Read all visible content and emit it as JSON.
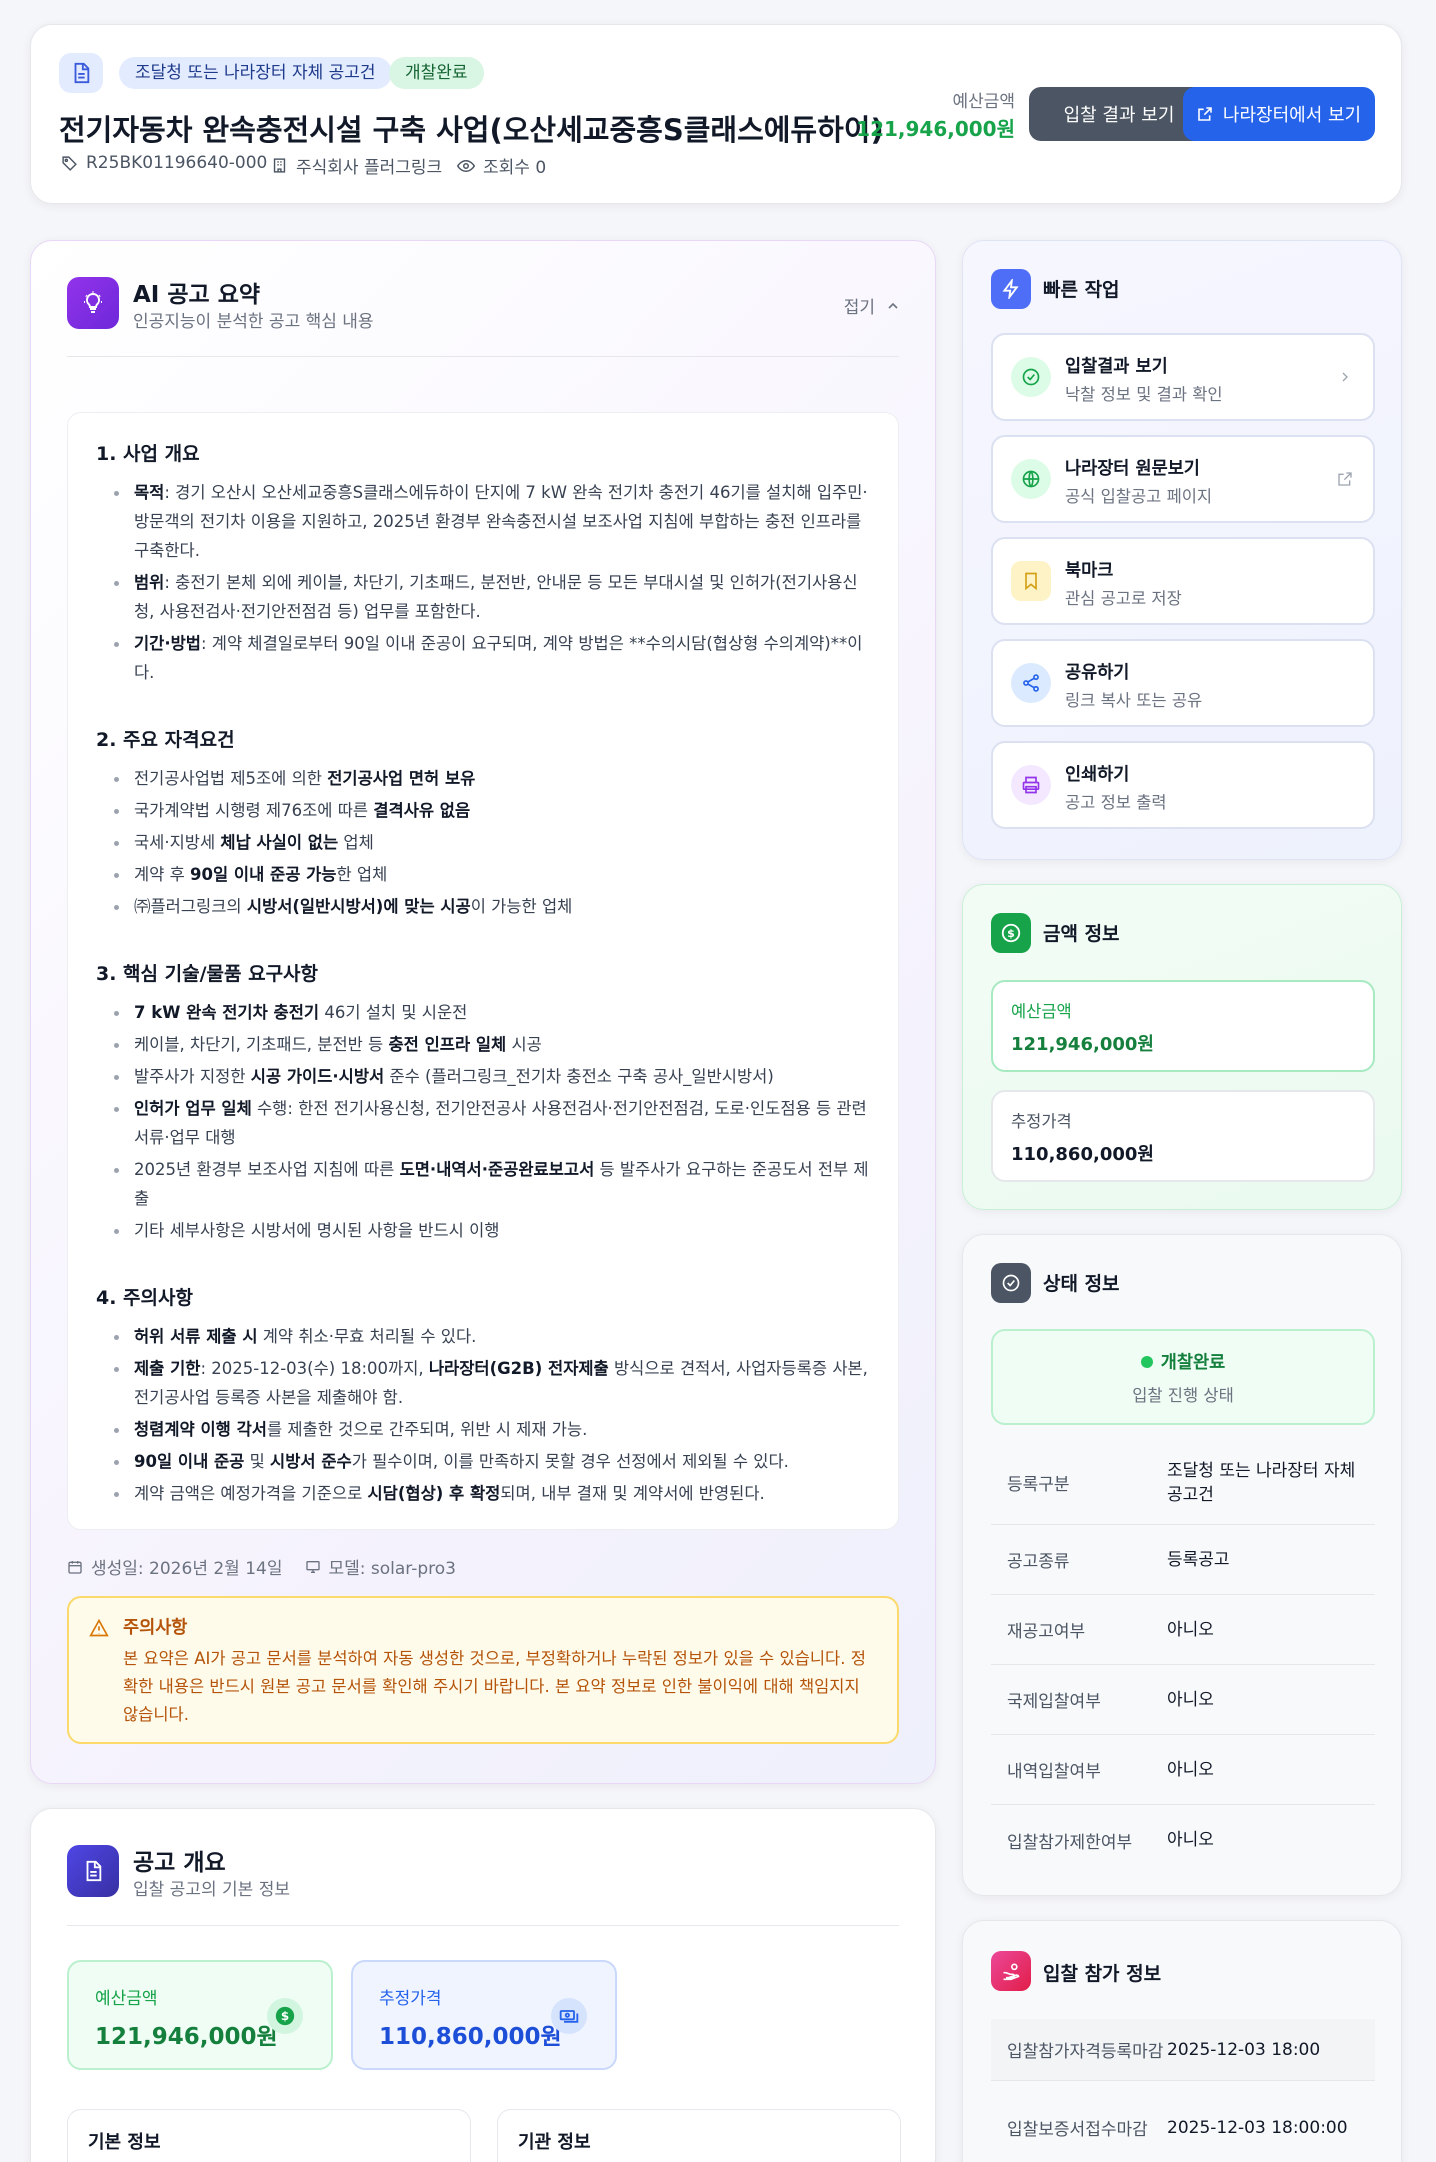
{
  "header": {
    "badges": [
      "조달청 또는 나라장터 자체 공고건",
      "개찰완료"
    ],
    "title": "전기자동차 완속충전시설 구축 사업(오산세교중흥S클래스에듀하이)",
    "notice_no": "R25BK01196640-000",
    "org": "주식회사 플러그링크",
    "views": "조회수 0",
    "budget_label": "예산금액",
    "budget_value": "121,946,000원",
    "btn_result": "입찰 결과 보기",
    "btn_g2b": "나라장터에서 보기",
    "colors": {
      "primary": "#2563eb",
      "success": "#16a34a",
      "dark": "#4b5563"
    }
  },
  "ai": {
    "title": "AI 공고 요약",
    "subtitle": "인공지능이 분석한 공고 핵심 내용",
    "collapse": "접기",
    "s1_title": "1. 사업 개요",
    "s1_i1_k": "목적",
    "s1_i1_v": ": 경기 오산시 오산세교중흥S클래스에듀하이 단지에 7 kW 완속 전기차 충전기 46기를 설치해 입주민·방문객의 전기차 이용을 지원하고, 2025년 환경부 완속충전시설 보조사업 지침에 부합하는 충전 인프라를 구축한다.",
    "s1_i2_k": "범위",
    "s1_i2_v": ": 충전기 본체 외에 케이블, 차단기, 기초패드, 분전반, 안내문 등 모든 부대시설 및 인허가(전기사용신청, 사용전검사·전기안전점검 등) 업무를 포함한다.",
    "s1_i3_k": "기간·방법",
    "s1_i3_v": ": 계약 체결일로부터 90일 이내 준공이 요구되며, 계약 방법은 **수의시담(협상형 수의계약)**이다.",
    "s2_title": "2. 주요 자격요건",
    "s2_i1_a": "전기공사업법 제5조에 의한 ",
    "s2_i1_b": "전기공사업 면허 보유",
    "s2_i2_a": "국가계약법 시행령 제76조에 따른 ",
    "s2_i2_b": "결격사유 없음",
    "s2_i3_a": "국세·지방세 ",
    "s2_i3_b": "체납 사실이 없는",
    "s2_i3_c": " 업체",
    "s2_i4_a": "계약 후 ",
    "s2_i4_b": "90일 이내 준공 가능",
    "s2_i4_c": "한 업체",
    "s2_i5_a": "㈜플러그링크의 ",
    "s2_i5_b": "시방서(일반시방서)에 맞는 시공",
    "s2_i5_c": "이 가능한 업체",
    "s3_title": "3. 핵심 기술/물품 요구사항",
    "s3_i1_b": "7 kW 완속 전기차 충전기",
    "s3_i1_c": " 46기 설치 및 시운전",
    "s3_i2_a": "케이블, 차단기, 기초패드, 분전반 등 ",
    "s3_i2_b": "충전 인프라 일체",
    "s3_i2_c": " 시공",
    "s3_i3_a": "발주사가 지정한 ",
    "s3_i3_b": "시공 가이드·시방서",
    "s3_i3_c": " 준수 (플러그링크_전기차 충전소 구축 공사_일반시방서)",
    "s3_i4_b": "인허가 업무 일체",
    "s3_i4_c": " 수행: 한전 전기사용신청, 전기안전공사 사용전검사·전기안전점검, 도로·인도점용 등 관련 서류·업무 대행",
    "s3_i5_a": "2025년 환경부 보조사업 지침에 따른 ",
    "s3_i5_b": "도면·내역서·준공완료보고서",
    "s3_i5_c": " 등 발주사가 요구하는 준공도서 전부 제출",
    "s3_i6": "기타 세부사항은 시방서에 명시된 사항을 반드시 이행",
    "s4_title": "4. 주의사항",
    "s4_i1_b": "허위 서류 제출 시",
    "s4_i1_c": " 계약 취소·무효 처리될 수 있다.",
    "s4_i2_b": "제출 기한",
    "s4_i2_c": ": 2025-12-03(수) 18:00까지, ",
    "s4_i2_d": "나라장터(G2B) 전자제출",
    "s4_i2_e": " 방식으로 견적서, 사업자등록증 사본, 전기공사업 등록증 사본을 제출해야 함.",
    "s4_i3_b": "청렴계약 이행 각서",
    "s4_i3_c": "를 제출한 것으로 간주되며, 위반 시 제재 가능.",
    "s4_i4_b": "90일 이내 준공",
    "s4_i4_c": " 및 ",
    "s4_i4_d": "시방서 준수",
    "s4_i4_e": "가 필수이며, 이를 만족하지 못할 경우 선정에서 제외될 수 있다.",
    "s4_i5_a": "계약 금액은 예정가격을 기준으로 ",
    "s4_i5_b": "시담(협상) 후 확정",
    "s4_i5_c": "되며, 내부 결재 및 계약서에 반영된다.",
    "generated": "생성일: 2026년 2월 14일",
    "model": "모델: solar-pro3",
    "warn_title": "주의사항",
    "warn_body": "본 요약은 AI가 공고 문서를 분석하여 자동 생성한 것으로, 부정확하거나 누락된 정보가 있을 수 있습니다. 정확한 내용은 반드시 원본 공고 문서를 확인해 주시기 바랍니다. 본 요약 정보로 인한 불이익에 대해 책임지지 않습니다."
  },
  "overview": {
    "title": "공고 개요",
    "subtitle": "입찰 공고의 기본 정보",
    "budget_label": "예산금액",
    "budget_value": "121,946,000원",
    "est_label": "추정가격",
    "est_value": "110,860,000원",
    "basic": "기본 정보",
    "agency": "기관 정보"
  },
  "quick": {
    "title": "빠른 작업",
    "items": [
      {
        "t": "입찰결과 보기",
        "s": "낙찰 정보 및 결과 확인"
      },
      {
        "t": "나라장터 원문보기",
        "s": "공식 입찰공고 페이지"
      },
      {
        "t": "북마크",
        "s": "관심 공고로 저장"
      },
      {
        "t": "공유하기",
        "s": "링크 복사 또는 공유"
      },
      {
        "t": "인쇄하기",
        "s": "공고 정보 출력"
      }
    ]
  },
  "money": {
    "title": "금액 정보",
    "budget_label": "예산금액",
    "budget_value": "121,946,000원",
    "est_label": "추정가격",
    "est_value": "110,860,000원"
  },
  "status": {
    "title": "상태 정보",
    "value": "개찰완료",
    "label": "입찰 진행 상태",
    "rows": [
      {
        "k": "등록구분",
        "v": "조달청 또는 나라장터 자체 공고건"
      },
      {
        "k": "공고종류",
        "v": "등록공고"
      },
      {
        "k": "재공고여부",
        "v": "아니오"
      },
      {
        "k": "국제입찰여부",
        "v": "아니오"
      },
      {
        "k": "내역입찰여부",
        "v": "아니오"
      },
      {
        "k": "입찰참가제한여부",
        "v": "아니오"
      }
    ]
  },
  "bid": {
    "title": "입찰 참가 정보",
    "rows": [
      {
        "k": "입찰참가자격등록마감",
        "v": "2025-12-03 18:00"
      },
      {
        "k": "입찰보증서접수마감",
        "v": "2025-12-03 18:00:00"
      }
    ]
  }
}
